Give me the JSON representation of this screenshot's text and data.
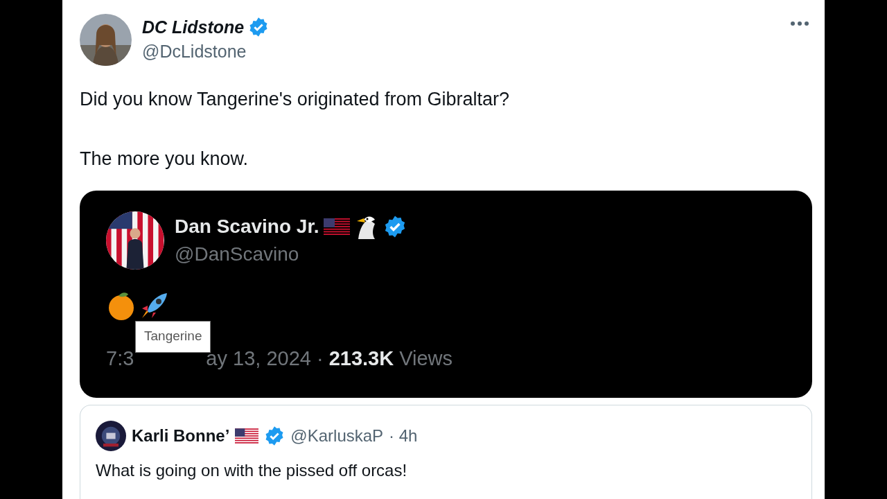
{
  "tweet": {
    "author": {
      "name": "DC Lidstone",
      "handle": "@DcLidstone",
      "verified": true
    },
    "paragraphs": [
      "Did you know Tangerine's originated from Gibraltar?",
      "The more you know."
    ],
    "media": {
      "author": {
        "name": "Dan Scavino Jr.",
        "handle": "@DanScavino",
        "verified": true
      },
      "time_start": "7:3",
      "time_end": "ay 13, 2024 ·",
      "views_count": "213.3K",
      "views_label": "Views",
      "tooltip": "Tangerine"
    },
    "reply": {
      "author": {
        "name": "Karli Bonne’",
        "handle": "@KarluskaP",
        "time": "· 4h",
        "verified": true
      },
      "text": "What is going on with the pissed off orcas!"
    }
  }
}
